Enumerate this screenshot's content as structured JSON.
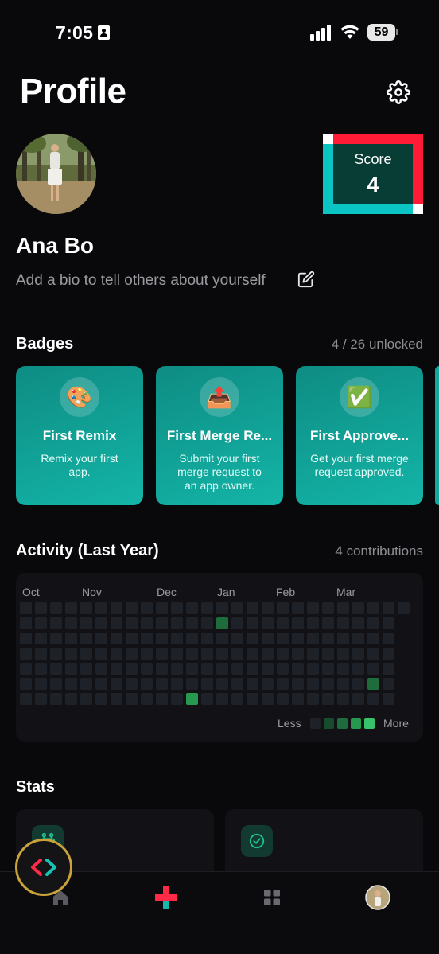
{
  "status_bar": {
    "time": "7:05",
    "battery": "59"
  },
  "header": {
    "title": "Profile"
  },
  "profile": {
    "name": "Ana Bo",
    "bio_placeholder": "Add a bio to tell others about yourself",
    "score_label": "Score",
    "score_value": "4"
  },
  "badges": {
    "title": "Badges",
    "unlocked": "4 / 26 unlocked",
    "items": [
      {
        "icon": "palette-icon",
        "emoji": "🎨",
        "title": "First Remix",
        "description": "Remix your first app."
      },
      {
        "icon": "outbox-tray-icon",
        "emoji": "📤",
        "title": "First Merge Re...",
        "description": "Submit your first merge request to an app owner."
      },
      {
        "icon": "check-mark-icon",
        "emoji": "✅",
        "title": "First Approve...",
        "description": "Get your first merge request approved."
      }
    ]
  },
  "activity": {
    "title": "Activity (Last Year)",
    "contributions": "4 contributions",
    "months": [
      "Oct",
      "Nov",
      "Dec",
      "Jan",
      "Feb",
      "Mar"
    ],
    "legend_less": "Less",
    "legend_more": "More",
    "active_days": [
      {
        "week": 13,
        "day": 1,
        "level": 2
      },
      {
        "week": 23,
        "day": 5,
        "level": 2
      },
      {
        "week": 11,
        "day": 6,
        "level": 3
      }
    ],
    "colors": {
      "empty": "#1e2228",
      "l1": "#174d2e",
      "l2": "#1e6b3c",
      "l3": "#27984f",
      "l4": "#38c26a"
    }
  },
  "stats": {
    "title": "Stats"
  },
  "nav": {
    "items": [
      "home-icon",
      "create-icon",
      "apps-grid-icon",
      "profile-avatar-icon"
    ]
  },
  "colors": {
    "accent_teal": "#14b5a8",
    "score_red": "#ff1a35",
    "score_cyan": "#0bc4c4",
    "fab_ring": "#c9a33a"
  }
}
